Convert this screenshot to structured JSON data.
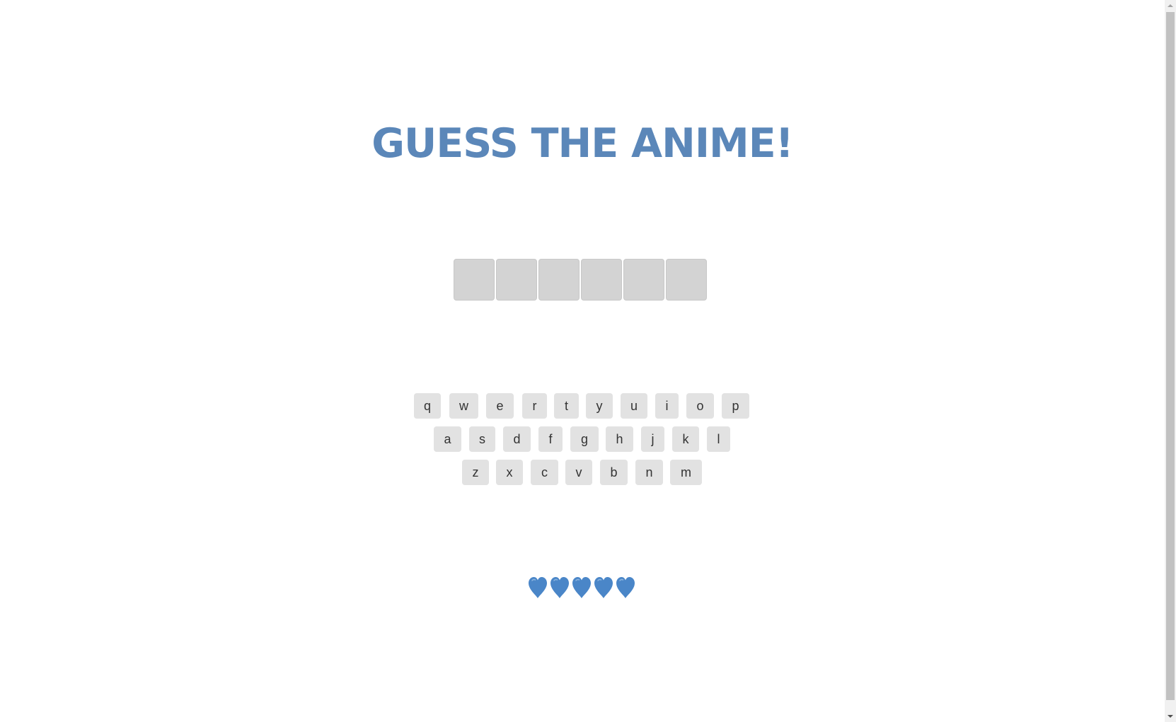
{
  "title": "GUESS THE ANIME!",
  "word_slots": [
    "",
    "",
    "",
    "",
    "",
    ""
  ],
  "keyboard": {
    "row1": [
      "q",
      "w",
      "e",
      "r",
      "t",
      "y",
      "u",
      "i",
      "o",
      "p"
    ],
    "row2": [
      "a",
      "s",
      "d",
      "f",
      "g",
      "h",
      "j",
      "k",
      "l"
    ],
    "row3": [
      "z",
      "x",
      "c",
      "v",
      "b",
      "n",
      "m"
    ]
  },
  "lives": {
    "remaining": 5,
    "icon": "blue-heart-icon",
    "color": "#4a86c8"
  },
  "colors": {
    "title": "#5b87b9",
    "slot": "#d3d3d3",
    "key": "#e2e2e2"
  }
}
